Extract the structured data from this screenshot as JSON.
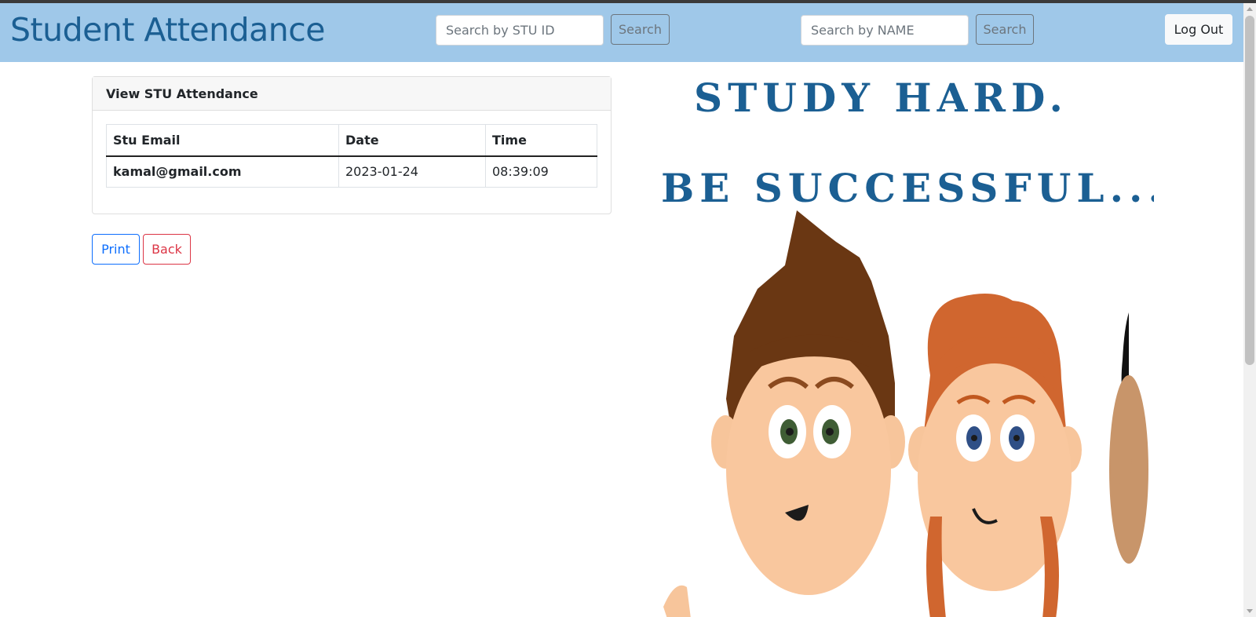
{
  "header": {
    "brand": "Student Attendance",
    "search_id": {
      "placeholder": "Search by STU ID",
      "button": "Search"
    },
    "search_name": {
      "placeholder": "Search by NAME",
      "button": "Search"
    },
    "logout_label": "Log Out"
  },
  "card": {
    "title": "View STU Attendance",
    "columns": [
      "Stu Email",
      "Date",
      "Time"
    ],
    "rows": [
      {
        "email": "kamal@gmail.com",
        "date": "2023-01-24",
        "time": "08:39:09"
      }
    ]
  },
  "actions": {
    "print": "Print",
    "back": "Back"
  },
  "poster": {
    "line1": "STUDY HARD.",
    "line2": "BE SUCCESSFUL..."
  },
  "colors": {
    "navbar": "#9fc8e9",
    "brand": "#1b5f93",
    "primary": "#0d6efd",
    "danger": "#dc3545"
  }
}
